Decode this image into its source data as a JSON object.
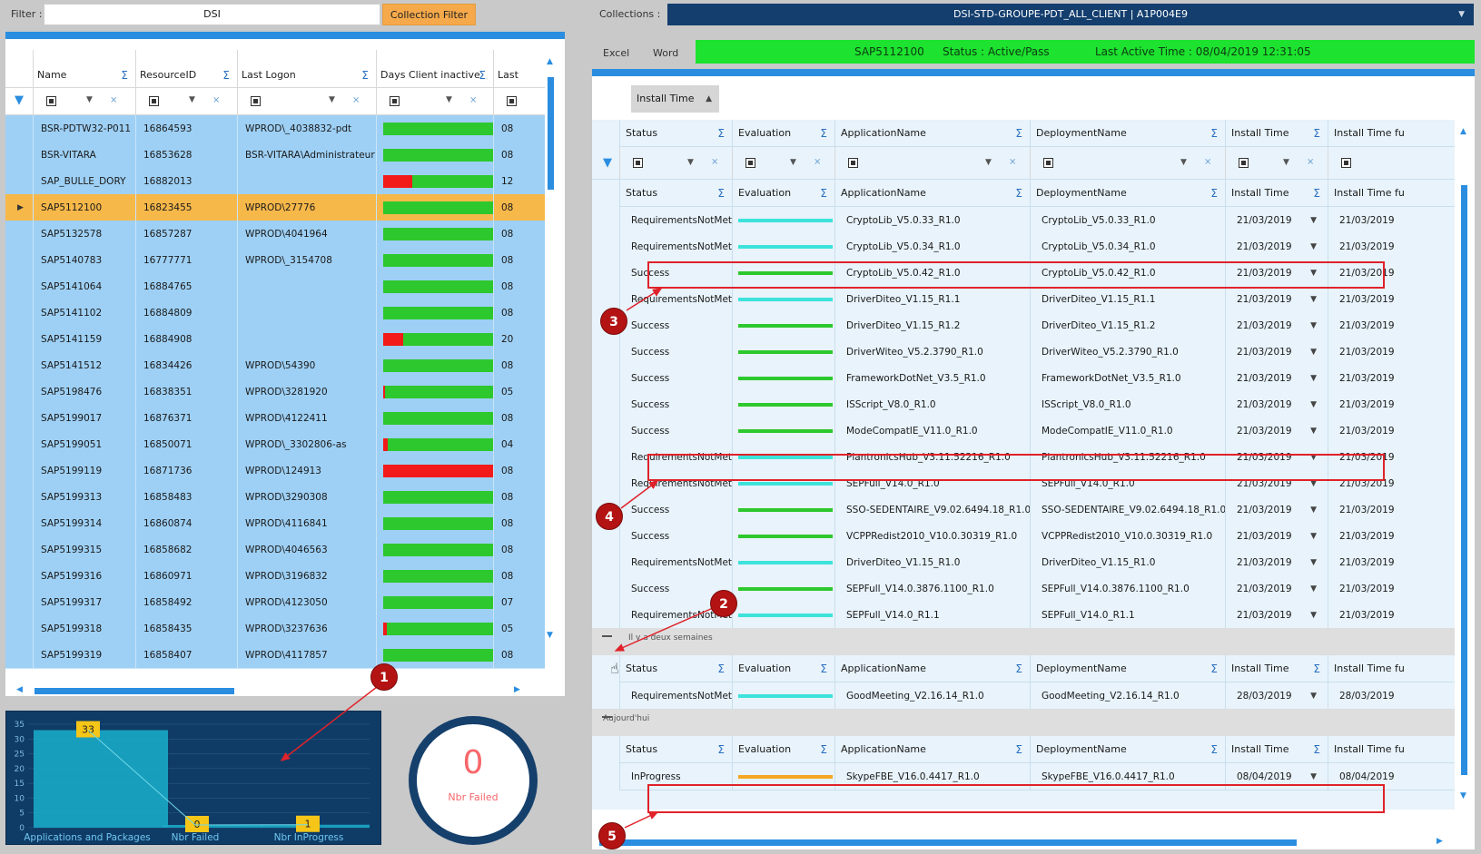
{
  "toolbar": {
    "filter_label": "Filter :",
    "filter_value": "DSI",
    "collection_filter_btn": "Collection Filter",
    "collections_label": "Collections :",
    "collection_selected": "DSI-STD-GROUPE-PDT_ALL_CLIENT  |  A1P004E9",
    "excel": "Excel",
    "word": "Word"
  },
  "status_bar": {
    "machine": "SAP5112100",
    "status": "Status  : Active/Pass",
    "last_active": "Last Active Time : 08/04/2019 12:31:05",
    "color": "#1de22f"
  },
  "left_grid": {
    "columns": [
      "Name",
      "ResourceID",
      "Last Logon",
      "Days Client inactive",
      "Last"
    ],
    "rows": [
      {
        "name": "BSR-PDTW32-P011",
        "id": "16864593",
        "logon": "WPROD\\_4038832-pdt",
        "red": 0,
        "last": "08"
      },
      {
        "name": "BSR-VITARA",
        "id": "16853628",
        "logon": "BSR-VITARA\\Administrateur",
        "red": 0,
        "last": "08"
      },
      {
        "name": "SAP_BULLE_DORY",
        "id": "16882013",
        "logon": "",
        "red": 0.26,
        "last": "12"
      },
      {
        "name": "SAP5112100",
        "id": "16823455",
        "logon": "WPROD\\27776",
        "red": 0,
        "last": "08",
        "selected": true
      },
      {
        "name": "SAP5132578",
        "id": "16857287",
        "logon": "WPROD\\4041964",
        "red": 0,
        "last": "08"
      },
      {
        "name": "SAP5140783",
        "id": "16777771",
        "logon": "WPROD\\_3154708",
        "red": 0,
        "last": "08"
      },
      {
        "name": "SAP5141064",
        "id": "16884765",
        "logon": "",
        "red": 0,
        "last": "08"
      },
      {
        "name": "SAP5141102",
        "id": "16884809",
        "logon": "",
        "red": 0,
        "last": "08"
      },
      {
        "name": "SAP5141159",
        "id": "16884908",
        "logon": "",
        "red": 0.18,
        "last": "20"
      },
      {
        "name": "SAP5141512",
        "id": "16834426",
        "logon": "WPROD\\54390",
        "red": 0,
        "last": "08"
      },
      {
        "name": "SAP5198476",
        "id": "16838351",
        "logon": "WPROD\\3281920",
        "red": 0.02,
        "last": "05"
      },
      {
        "name": "SAP5199017",
        "id": "16876371",
        "logon": "WPROD\\4122411",
        "red": 0,
        "last": "08"
      },
      {
        "name": "SAP5199051",
        "id": "16850071",
        "logon": "WPROD\\_3302806-as",
        "red": 0.04,
        "last": "04"
      },
      {
        "name": "SAP5199119",
        "id": "16871736",
        "logon": "WPROD\\124913",
        "red": 1,
        "last": "08"
      },
      {
        "name": "SAP5199313",
        "id": "16858483",
        "logon": "WPROD\\3290308",
        "red": 0,
        "last": "08"
      },
      {
        "name": "SAP5199314",
        "id": "16860874",
        "logon": "WPROD\\4116841",
        "red": 0,
        "last": "08"
      },
      {
        "name": "SAP5199315",
        "id": "16858682",
        "logon": "WPROD\\4046563",
        "red": 0,
        "last": "08"
      },
      {
        "name": "SAP5199316",
        "id": "16860971",
        "logon": "WPROD\\3196832",
        "red": 0,
        "last": "08"
      },
      {
        "name": "SAP5199317",
        "id": "16858492",
        "logon": "WPROD\\4123050",
        "red": 0,
        "last": "07"
      },
      {
        "name": "SAP5199318",
        "id": "16858435",
        "logon": "WPROD\\3237636",
        "red": 0.03,
        "last": "05"
      },
      {
        "name": "SAP5199319",
        "id": "16858407",
        "logon": "WPROD\\4117857",
        "red": 0,
        "last": "08"
      }
    ]
  },
  "chart_data": {
    "type": "bar",
    "categories": [
      "Applications and Packages",
      "Nbr Failed",
      "Nbr InProgress"
    ],
    "values": [
      33,
      0,
      1
    ],
    "ylim": [
      0,
      35
    ],
    "yticks": [
      "35",
      "30",
      "25",
      "20",
      "15",
      "10",
      "5",
      "0"
    ],
    "bar_color": "#1aa8c7",
    "label_color": "#f5c518"
  },
  "gauge": {
    "value": "0",
    "label": "Nbr Failed"
  },
  "right_grid": {
    "group_by": "Install Time",
    "columns": [
      "Status",
      "Evaluation",
      "ApplicationName",
      "DeploymentName",
      "Install Time",
      "Install Time fu"
    ],
    "group1_rows": [
      {
        "status": "RequirementsNotMet",
        "eval": "cyan",
        "app": "CryptoLib_V5.0.33_R1.0",
        "dep": "CryptoLib_V5.0.33_R1.0",
        "time": "21/03/2019",
        "timefu": "21/03/2019"
      },
      {
        "status": "RequirementsNotMet",
        "eval": "cyan",
        "app": "CryptoLib_V5.0.34_R1.0",
        "dep": "CryptoLib_V5.0.34_R1.0",
        "time": "21/03/2019",
        "timefu": "21/03/2019"
      },
      {
        "status": "Success",
        "eval": "green",
        "app": "CryptoLib_V5.0.42_R1.0",
        "dep": "CryptoLib_V5.0.42_R1.0",
        "time": "21/03/2019",
        "timefu": "21/03/2019"
      },
      {
        "status": "RequirementsNotMet",
        "eval": "cyan",
        "app": "DriverDiteo_V1.15_R1.1",
        "dep": "DriverDiteo_V1.15_R1.1",
        "time": "21/03/2019",
        "timefu": "21/03/2019"
      },
      {
        "status": "Success",
        "eval": "green",
        "app": "DriverDiteo_V1.15_R1.2",
        "dep": "DriverDiteo_V1.15_R1.2",
        "time": "21/03/2019",
        "timefu": "21/03/2019"
      },
      {
        "status": "Success",
        "eval": "green",
        "app": "DriverWiteo_V5.2.3790_R1.0",
        "dep": "DriverWiteo_V5.2.3790_R1.0",
        "time": "21/03/2019",
        "timefu": "21/03/2019"
      },
      {
        "status": "Success",
        "eval": "green",
        "app": "FrameworkDotNet_V3.5_R1.0",
        "dep": "FrameworkDotNet_V3.5_R1.0",
        "time": "21/03/2019",
        "timefu": "21/03/2019"
      },
      {
        "status": "Success",
        "eval": "green",
        "app": "ISScript_V8.0_R1.0",
        "dep": "ISScript_V8.0_R1.0",
        "time": "21/03/2019",
        "timefu": "21/03/2019"
      },
      {
        "status": "Success",
        "eval": "green",
        "app": "ModeCompatIE_V11.0_R1.0",
        "dep": "ModeCompatIE_V11.0_R1.0",
        "time": "21/03/2019",
        "timefu": "21/03/2019"
      },
      {
        "status": "RequirementsNotMet",
        "eval": "cyan",
        "app": "PlantronicsHub_V3.11.52216_R1.0",
        "dep": "PlantronicsHub_V3.11.52216_R1.0",
        "time": "21/03/2019",
        "timefu": "21/03/2019"
      },
      {
        "status": "RequirementsNotMet",
        "eval": "cyan",
        "app": "SEPFull_V14.0_R1.0",
        "dep": "SEPFull_V14.0_R1.0",
        "time": "21/03/2019",
        "timefu": "21/03/2019"
      },
      {
        "status": "Success",
        "eval": "green",
        "app": "SSO-SEDENTAIRE_V9.02.6494.18_R1.0",
        "dep": "SSO-SEDENTAIRE_V9.02.6494.18_R1.0",
        "time": "21/03/2019",
        "timefu": "21/03/2019"
      },
      {
        "status": "Success",
        "eval": "green",
        "app": "VCPPRedist2010_V10.0.30319_R1.0",
        "dep": "VCPPRedist2010_V10.0.30319_R1.0",
        "time": "21/03/2019",
        "timefu": "21/03/2019"
      },
      {
        "status": "RequirementsNotMet",
        "eval": "cyan",
        "app": "DriverDiteo_V1.15_R1.0",
        "dep": "DriverDiteo_V1.15_R1.0",
        "time": "21/03/2019",
        "timefu": "21/03/2019"
      },
      {
        "status": "Success",
        "eval": "green",
        "app": "SEPFull_V14.0.3876.1100_R1.0",
        "dep": "SEPFull_V14.0.3876.1100_R1.0",
        "time": "21/03/2019",
        "timefu": "21/03/2019"
      },
      {
        "status": "RequirementsNotMet",
        "eval": "cyan",
        "app": "SEPFull_V14.0_R1.1",
        "dep": "SEPFull_V14.0_R1.1",
        "time": "21/03/2019",
        "timefu": "21/03/2019"
      }
    ],
    "group2_label": "Il y a deux semaines",
    "group2_rows": [
      {
        "status": "RequirementsNotMet",
        "eval": "cyan",
        "app": "GoodMeeting_V2.16.14_R1.0",
        "dep": "GoodMeeting_V2.16.14_R1.0",
        "time": "28/03/2019",
        "timefu": "28/03/2019"
      }
    ],
    "group3_label": "Aujourd'hui",
    "group3_rows": [
      {
        "status": "InProgress",
        "eval": "orange",
        "app": "SkypeFBE_V16.0.4417_R1.0",
        "dep": "SkypeFBE_V16.0.4417_R1.0",
        "time": "08/04/2019",
        "timefu": "08/04/2019"
      }
    ]
  },
  "annotations": [
    "1",
    "2",
    "3",
    "4",
    "5"
  ],
  "colors": {
    "green": "#2dc82d",
    "red": "#f31a1a",
    "cyan": "#3de3da",
    "orange": "#f5a623",
    "accent": "#2a8de0",
    "selected_row": "#f7b84a",
    "annotation": "#b31313"
  }
}
